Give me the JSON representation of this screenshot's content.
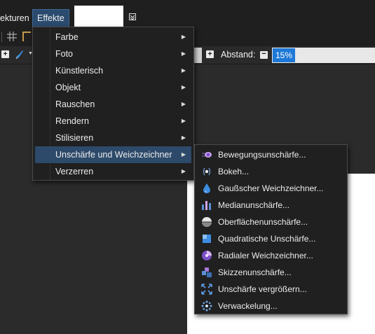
{
  "menubar": {
    "items": [
      {
        "label": "ekturen"
      },
      {
        "label": "Effekte"
      }
    ]
  },
  "toolbar": {
    "spacing_label": "Abstand:",
    "spacing_value": "15%",
    "plus_symbol": "+",
    "minus_symbol": "−"
  },
  "effects_menu": {
    "items": [
      {
        "label": "Farbe"
      },
      {
        "label": "Foto"
      },
      {
        "label": "Künstlerisch"
      },
      {
        "label": "Objekt"
      },
      {
        "label": "Rauschen"
      },
      {
        "label": "Rendern"
      },
      {
        "label": "Stilisieren"
      },
      {
        "label": "Unschärfe und Weichzeichner",
        "active": true
      },
      {
        "label": "Verzerren"
      }
    ],
    "arrow": "▶"
  },
  "blur_submenu": {
    "items": [
      {
        "label": "Bewegungsunschärfe...",
        "icon": "motion-blur-icon"
      },
      {
        "label": "Bokeh...",
        "icon": "bokeh-icon"
      },
      {
        "label": "Gaußscher Weichzeichner...",
        "icon": "gaussian-blur-icon"
      },
      {
        "label": "Medianunschärfe...",
        "icon": "median-blur-icon"
      },
      {
        "label": "Oberflächenunschärfe...",
        "icon": "surface-blur-icon"
      },
      {
        "label": "Quadratische Unschärfe...",
        "icon": "box-blur-icon"
      },
      {
        "label": "Radialer Weichzeichner...",
        "icon": "radial-blur-icon"
      },
      {
        "label": "Skizzenunschärfe...",
        "icon": "sketch-blur-icon"
      },
      {
        "label": "Unschärfe vergrößern...",
        "icon": "zoom-blur-icon"
      },
      {
        "label": "Verwackelung...",
        "icon": "unfocus-icon"
      }
    ]
  },
  "colors": {
    "accent": "#1e78d7",
    "menu_bg": "#202020",
    "highlight": "#2d4a6a"
  }
}
